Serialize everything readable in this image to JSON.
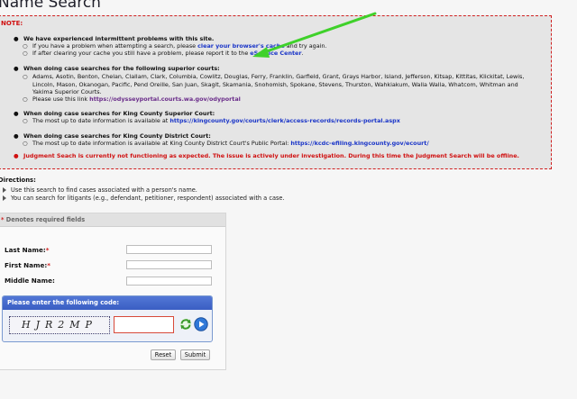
{
  "page": {
    "title": "Name Search"
  },
  "note": {
    "label": "NOTE:",
    "items": [
      {
        "head": "We have experienced intermittent problems with this site.",
        "subs": [
          {
            "pre": "If you have a problem when attempting a search, please ",
            "link": "clear your browser's cache",
            "post": " and try again."
          },
          {
            "pre": "If after clearing your cache you still have a problem, please report it to the ",
            "link": "eService Center",
            "post": "."
          }
        ]
      },
      {
        "head": "When doing case searches for the following superior courts:",
        "subs": [
          {
            "pre": "Adams, Asotin, Benton, Chelan, Clallam, Clark, Columbia, Cowlitz, Douglas, Ferry, Franklin, Garfield, Grant, Grays Harbor, Island, Jefferson, Kitsap, Kittitas, Klickitat, Lewis, Lincoln, Mason, Okanogan, Pacific, Pend Oreille, San Juan, Skagit, Skamania, Snohomish, Spokane, Stevens, Thurston, Wahkiakum, Walla Walla, Whatcom, Whitman and Yakima Superior Courts.",
            "link": "",
            "post": ""
          },
          {
            "pre": "Please use this link ",
            "link": "https://odysseyportal.courts.wa.gov/odyportal",
            "post": ""
          }
        ]
      },
      {
        "head": "When doing case searches for King County Superior Court:",
        "subs": [
          {
            "pre": "The most up to date information is available at ",
            "link": "https://kingcounty.gov/courts/clerk/access-records/records-portal.aspx",
            "post": ""
          }
        ]
      },
      {
        "head": "When doing case searches for King County District Court:",
        "subs": [
          {
            "pre": "The most up to date information is available at King County District Court's Public Portal: ",
            "link": "https://kcdc-efiling.kingcounty.gov/ecourt/",
            "post": ""
          }
        ]
      }
    ],
    "alert": "Judgment Seach is currently not functioning as expected. The issue is actively under investigation. During this time the Judgment Search will be offline."
  },
  "directions": {
    "title": "Directions:",
    "items": [
      "Use this search to find cases associated with a person's name.",
      "You can search for litigants (e.g., defendant, petitioner, respondent) associated with a case."
    ]
  },
  "form": {
    "required_note": "Denotes required fields",
    "required_star": "*",
    "last_name_label": "Last Name:",
    "first_name_label": "First Name:",
    "middle_name_label": "Middle Name:",
    "last_name_value": "",
    "first_name_value": "",
    "middle_name_value": "",
    "captcha_title": "Please enter the following code:",
    "captcha_code": "HJR2MP",
    "captcha_value": "",
    "reset_label": "Reset",
    "submit_label": "Submit"
  },
  "colors": {
    "accent": "#3a5ec3",
    "alert": "#d01010",
    "link": "#1a35c8",
    "annotation_arrow": "#3fd12a"
  },
  "icons": [
    "refresh-icon",
    "audio-play-icon",
    "bullet-icon",
    "triangle-bullet-icon"
  ]
}
